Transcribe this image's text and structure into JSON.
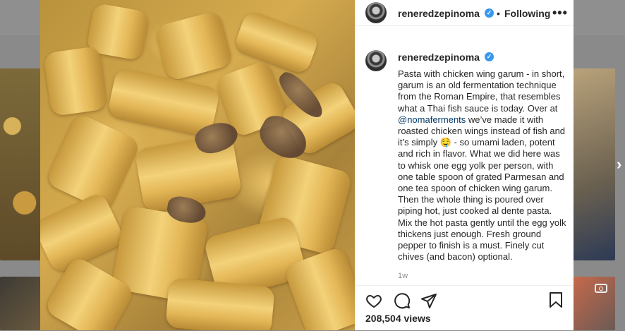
{
  "post": {
    "username": "reneredzepinoma",
    "verified_mark": "✓",
    "separator": "•",
    "follow_status": "Following",
    "more_label": "•••",
    "caption_before": "Pasta with chicken wing garum - in short, garum is an old fermentation technique from the Roman Empire, that resembles what a Thai fish sauce is today. Over at ",
    "caption_mention": "@nomaferments",
    "caption_after": " we’ve made it with roasted chicken wings instead of fish and it’s simply 🤤  - so umami laden, potent and rich in flavor. What we did here was to whisk one egg yolk per person, with one table spoon of grated Parmesan and one tea spoon of chicken wing garum. Then the whole thing is poured over piping hot, just cooked al dente pasta. Mix the hot pasta gently until the egg yolk thickens just enough. Fresh ground pepper to finish is a must. Finely cut chives (and bacon) optional.",
    "age": "1w",
    "views": "208,504 views"
  },
  "icons": {
    "like": "heart-icon",
    "comment": "comment-icon",
    "share": "paper-plane-icon",
    "save": "bookmark-icon",
    "next": "chevron-right-icon",
    "camera": "camera-icon"
  },
  "colors": {
    "verified": "#3897f0",
    "text": "#262626",
    "mention": "#00376b",
    "muted": "#8e8e8e"
  }
}
